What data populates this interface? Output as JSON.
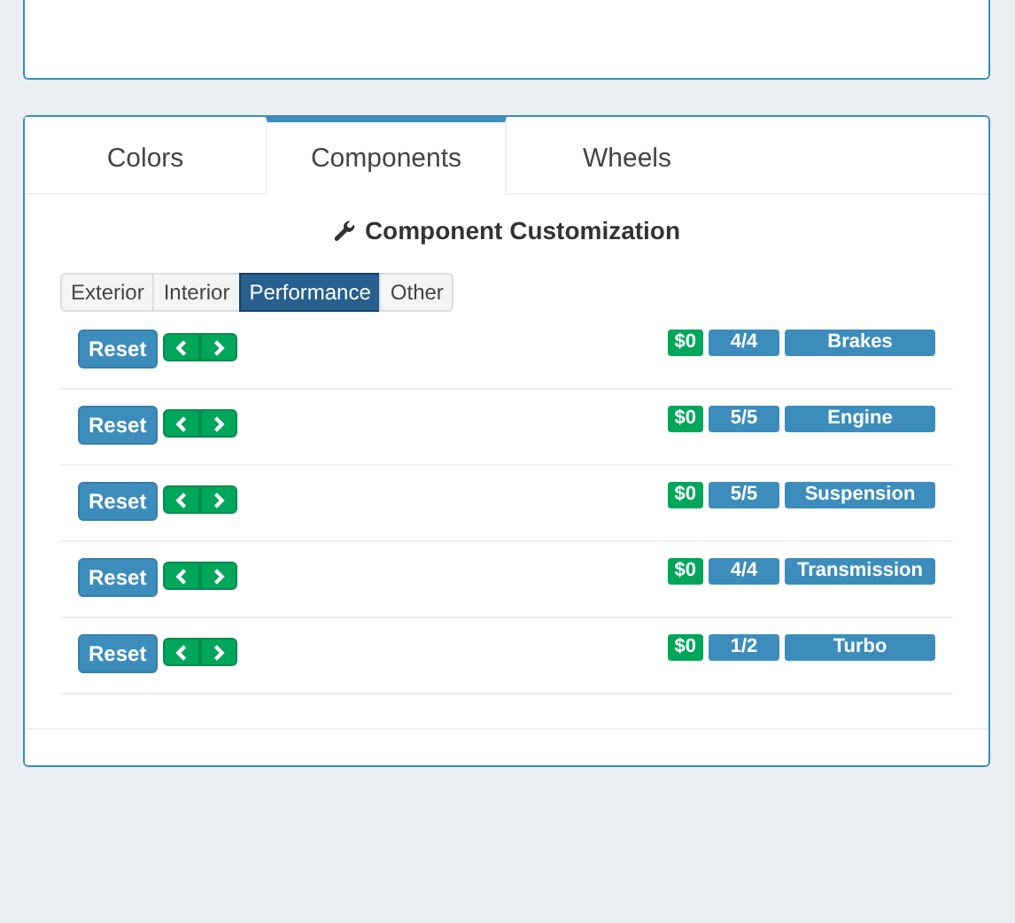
{
  "tabs": [
    {
      "label": "Colors",
      "selected": false
    },
    {
      "label": "Components",
      "selected": true
    },
    {
      "label": "Wheels",
      "selected": false
    }
  ],
  "section_title": "Component Customization",
  "categories": [
    {
      "label": "Exterior",
      "selected": false
    },
    {
      "label": "Interior",
      "selected": false
    },
    {
      "label": "Performance",
      "selected": true
    },
    {
      "label": "Other",
      "selected": false
    }
  ],
  "components": [
    {
      "reset": "Reset",
      "price": "$0",
      "count": "4/4",
      "name": "Brakes"
    },
    {
      "reset": "Reset",
      "price": "$0",
      "count": "5/5",
      "name": "Engine"
    },
    {
      "reset": "Reset",
      "price": "$0",
      "count": "5/5",
      "name": "Suspension"
    },
    {
      "reset": "Reset",
      "price": "$0",
      "count": "4/4",
      "name": "Transmission"
    },
    {
      "reset": "Reset",
      "price": "$0",
      "count": "1/2",
      "name": "Turbo"
    }
  ]
}
